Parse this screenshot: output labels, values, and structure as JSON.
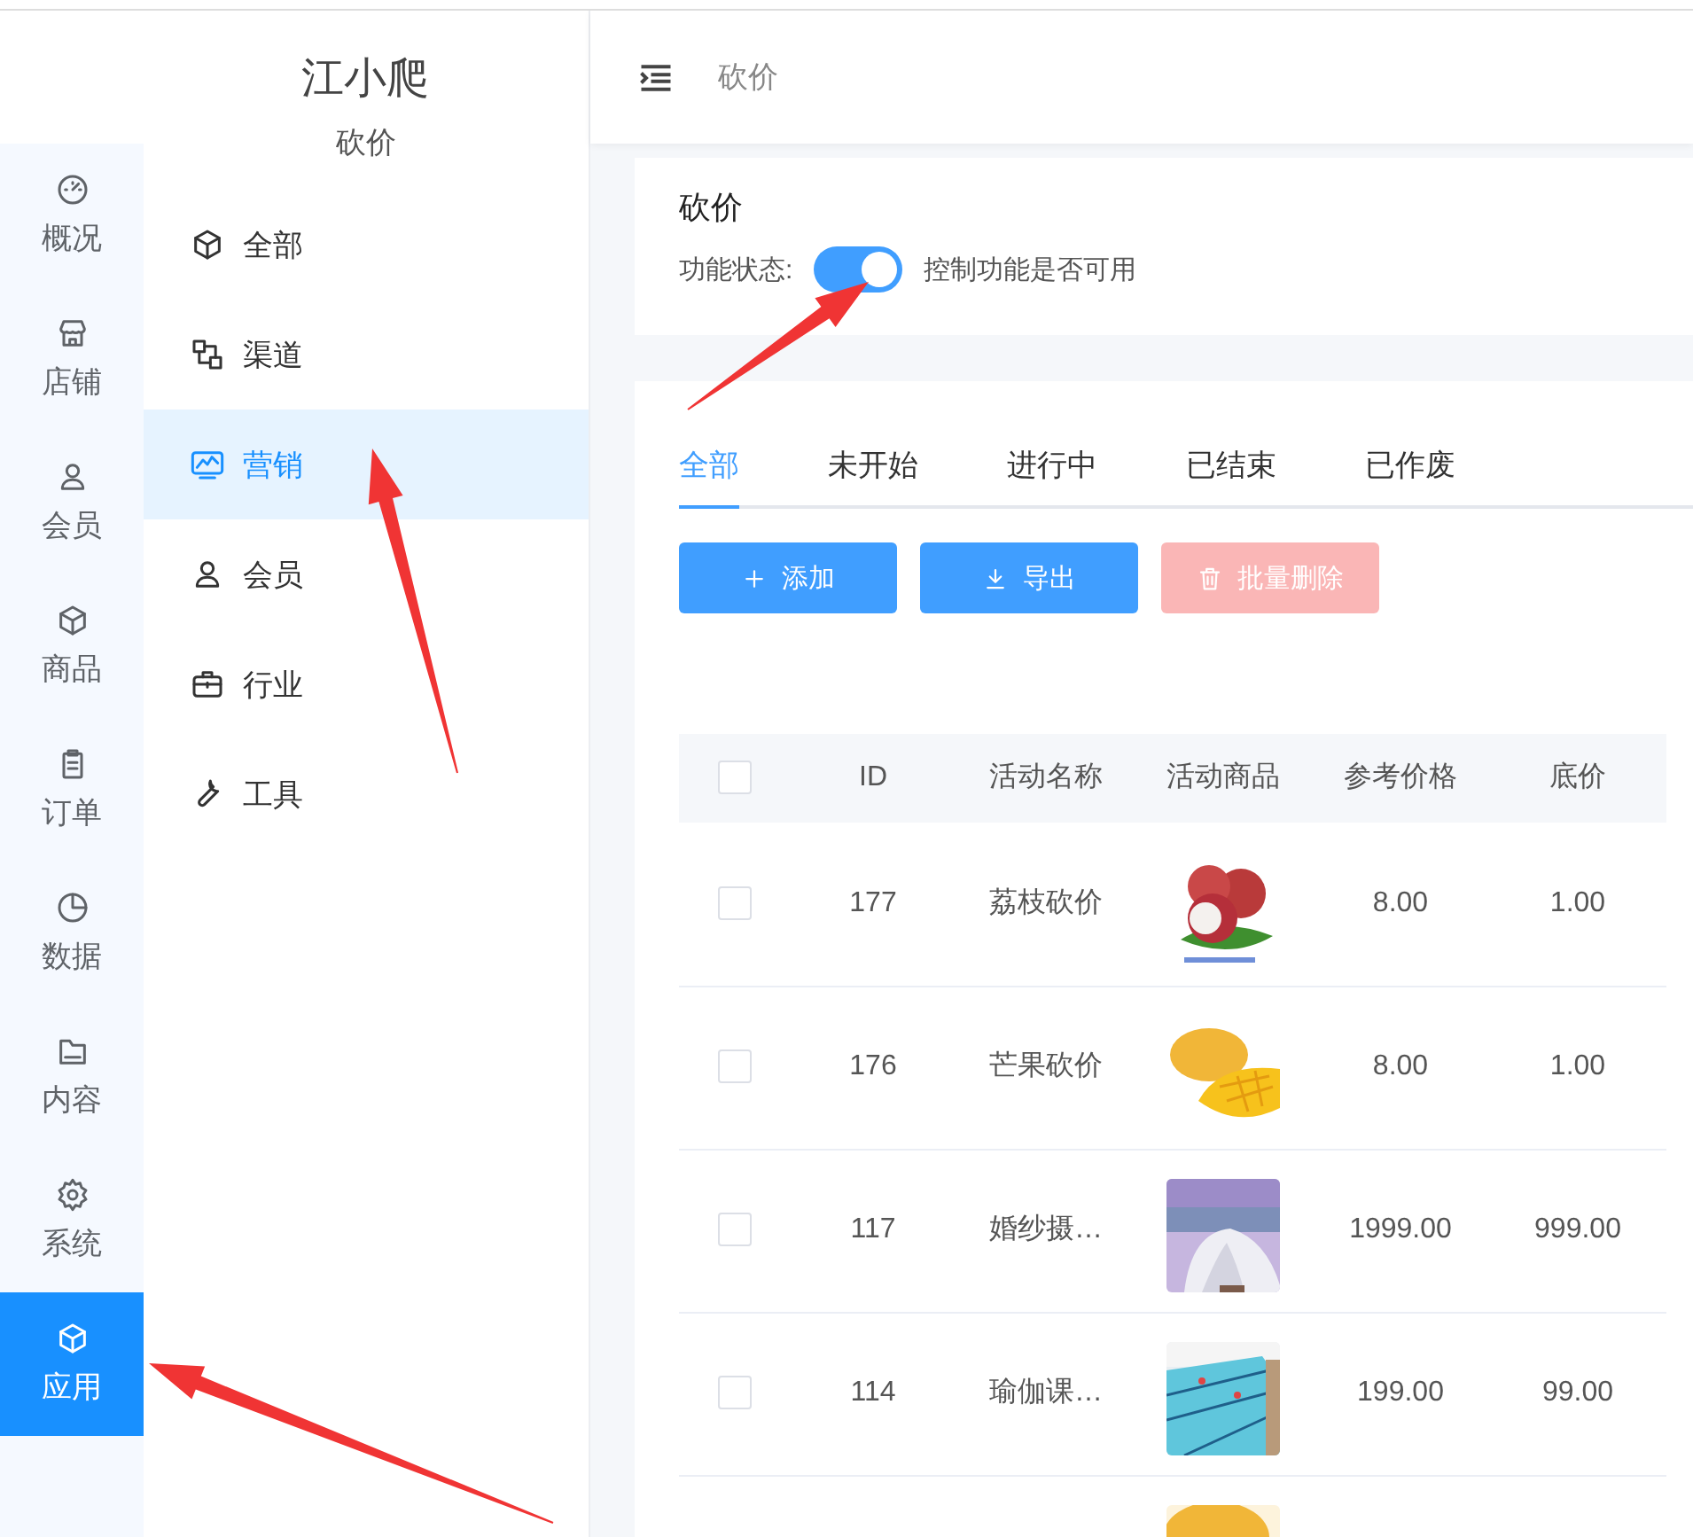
{
  "brand": {
    "title": "江小爬",
    "section": "砍价"
  },
  "rail": [
    {
      "label": "概况",
      "selected": false
    },
    {
      "label": "店铺",
      "selected": false
    },
    {
      "label": "会员",
      "selected": false
    },
    {
      "label": "商品",
      "selected": false
    },
    {
      "label": "订单",
      "selected": false
    },
    {
      "label": "数据",
      "selected": false
    },
    {
      "label": "内容",
      "selected": false
    },
    {
      "label": "系统",
      "selected": false
    },
    {
      "label": "应用",
      "selected": true
    }
  ],
  "submenu": [
    {
      "label": "全部",
      "selected": false
    },
    {
      "label": "渠道",
      "selected": false
    },
    {
      "label": "营销",
      "selected": true
    },
    {
      "label": "会员",
      "selected": false
    },
    {
      "label": "行业",
      "selected": false
    },
    {
      "label": "工具",
      "selected": false
    }
  ],
  "header": {
    "breadcrumb": "砍价"
  },
  "feature": {
    "title": "砍价",
    "status_label": "功能状态:",
    "on": true,
    "hint": "控制功能是否可用"
  },
  "tabs": [
    {
      "label": "全部",
      "selected": true
    },
    {
      "label": "未开始",
      "selected": false
    },
    {
      "label": "进行中",
      "selected": false
    },
    {
      "label": "已结束",
      "selected": false
    },
    {
      "label": "已作废",
      "selected": false
    }
  ],
  "buttons": [
    {
      "kind": "add",
      "label": "添加",
      "disabled": false
    },
    {
      "kind": "export",
      "label": "导出",
      "disabled": false
    },
    {
      "kind": "delete",
      "label": "批量删除",
      "disabled": true
    }
  ],
  "table": {
    "select_all_checked": false,
    "columns": [
      "ID",
      "活动名称",
      "活动商品",
      "参考价格",
      "底价"
    ],
    "rows": [
      {
        "checked": false,
        "id": "177",
        "name": "荔枝砍价",
        "product": {
          "kind": "picture"
        },
        "reference_price": "8.00",
        "floor_price": "1.00"
      },
      {
        "checked": false,
        "id": "176",
        "name": "芒果砍价",
        "product": {
          "kind": "picture"
        },
        "reference_price": "8.00",
        "floor_price": "1.00"
      },
      {
        "checked": false,
        "id": "117",
        "name": "婚纱摄…",
        "product": {
          "kind": "picture"
        },
        "reference_price": "1999.00",
        "floor_price": "999.00"
      },
      {
        "checked": false,
        "id": "114",
        "name": "瑜伽课…",
        "product": {
          "kind": "picture"
        },
        "reference_price": "199.00",
        "floor_price": "99.00"
      },
      {
        "product": {
          "kind": "picture"
        }
      }
    ]
  }
}
